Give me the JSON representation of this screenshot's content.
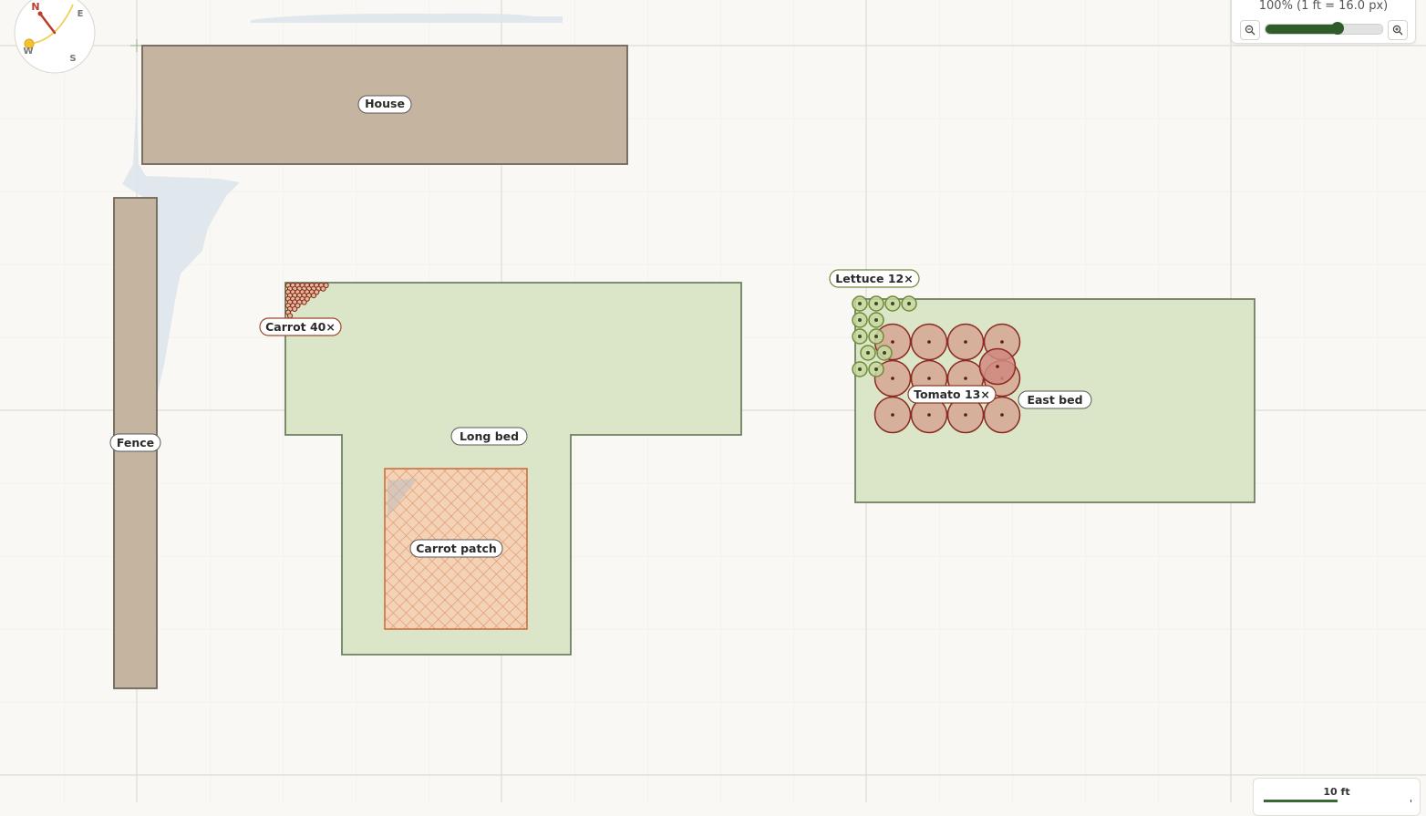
{
  "compass": {
    "north": "N",
    "east": "E",
    "south": "S",
    "west": "W"
  },
  "zoom": {
    "readout": "100% (1 ft = 16.0 px)",
    "level": 0.62
  },
  "scale": {
    "label": "10 ft"
  },
  "objects": {
    "house": "House",
    "fence": "Fence",
    "long_bed": "Long bed",
    "carrot_patch": "Carrot patch",
    "east_bed": "East bed"
  },
  "plantings": {
    "carrot": "Carrot 40×",
    "lettuce": "Lettuce 12×",
    "tomato": "Tomato 13×"
  },
  "colors": {
    "structure": "#c4b4a0",
    "bed": "#dbe6c8",
    "carrot_patch": "#f0c4a4",
    "tomato": "#d6a694",
    "lettuce": "#c8d8a0",
    "accent": "#2f5d2a"
  }
}
